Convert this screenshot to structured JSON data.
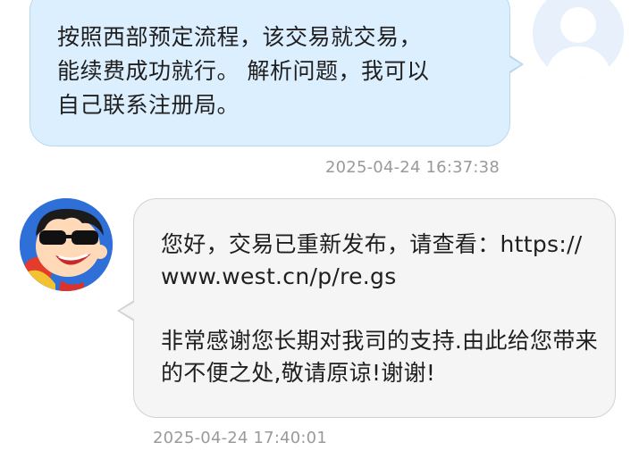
{
  "messages": {
    "outgoing": {
      "text": "按照西部预定流程，该交易就交易，\n能续费成功就行。 解析问题，我可以\n自己联系注册局。",
      "timestamp": "2025-04-24 16:37:38"
    },
    "incoming": {
      "paragraph1": "您好，交易已重新发布，请查看：https://www.west.cn/p/re.gs",
      "paragraph2": "非常感谢您长期对我司的支持.由此给您带来的不便之处,敬请原谅!谢谢!",
      "timestamp": "2025-04-24 17:40:01"
    }
  },
  "colors": {
    "outgoing_bubble": "#dcefff",
    "incoming_bubble": "#f5f5f5",
    "timestamp": "#9a9a9a"
  },
  "icons": {
    "user_avatar": "default-person-avatar-icon",
    "support_avatar": "cartoon-mascot-sunglasses-icon"
  }
}
